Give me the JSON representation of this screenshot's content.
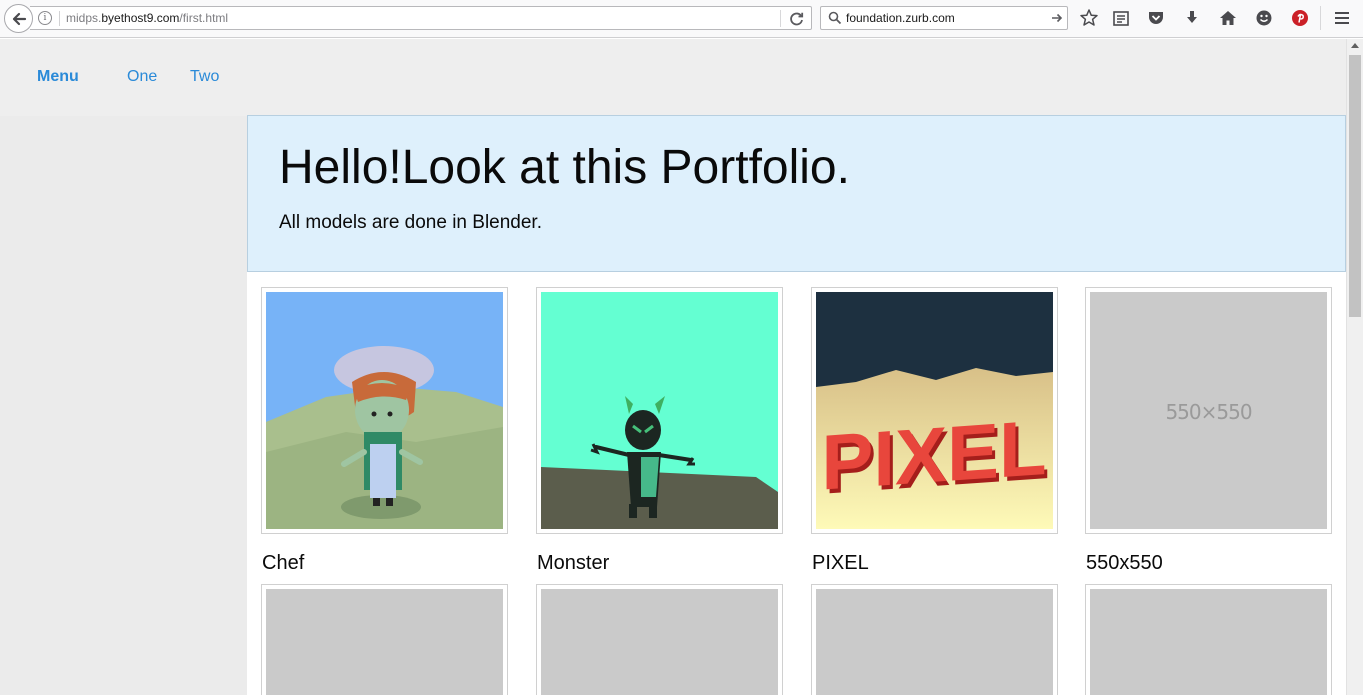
{
  "browser": {
    "url_prefix": "midps.",
    "url_domain": "byethost9.com",
    "url_path": "/first.html",
    "search_value": "foundation.zurb.com",
    "info_glyph": "i"
  },
  "nav": {
    "items": [
      {
        "label": "Menu",
        "bold": true
      },
      {
        "label": "One",
        "bold": false
      },
      {
        "label": "Two",
        "bold": false
      }
    ]
  },
  "callout": {
    "title": "Hello!Look at this Portfolio.",
    "subtitle": "All models are done in Blender."
  },
  "gallery": {
    "items": [
      {
        "caption": "Chef",
        "image": "chef-render"
      },
      {
        "caption": "Monster",
        "image": "monster-render"
      },
      {
        "caption": "PIXEL",
        "image": "pixel-render",
        "image_text": "PIXEL"
      },
      {
        "caption": "550x550",
        "image": "placeholder",
        "image_text": "550×550"
      }
    ],
    "second_row_count": 4
  },
  "colors": {
    "link": "#2a8ad8",
    "callout_bg": "#def0fc",
    "placeholder": "#cacaca"
  }
}
